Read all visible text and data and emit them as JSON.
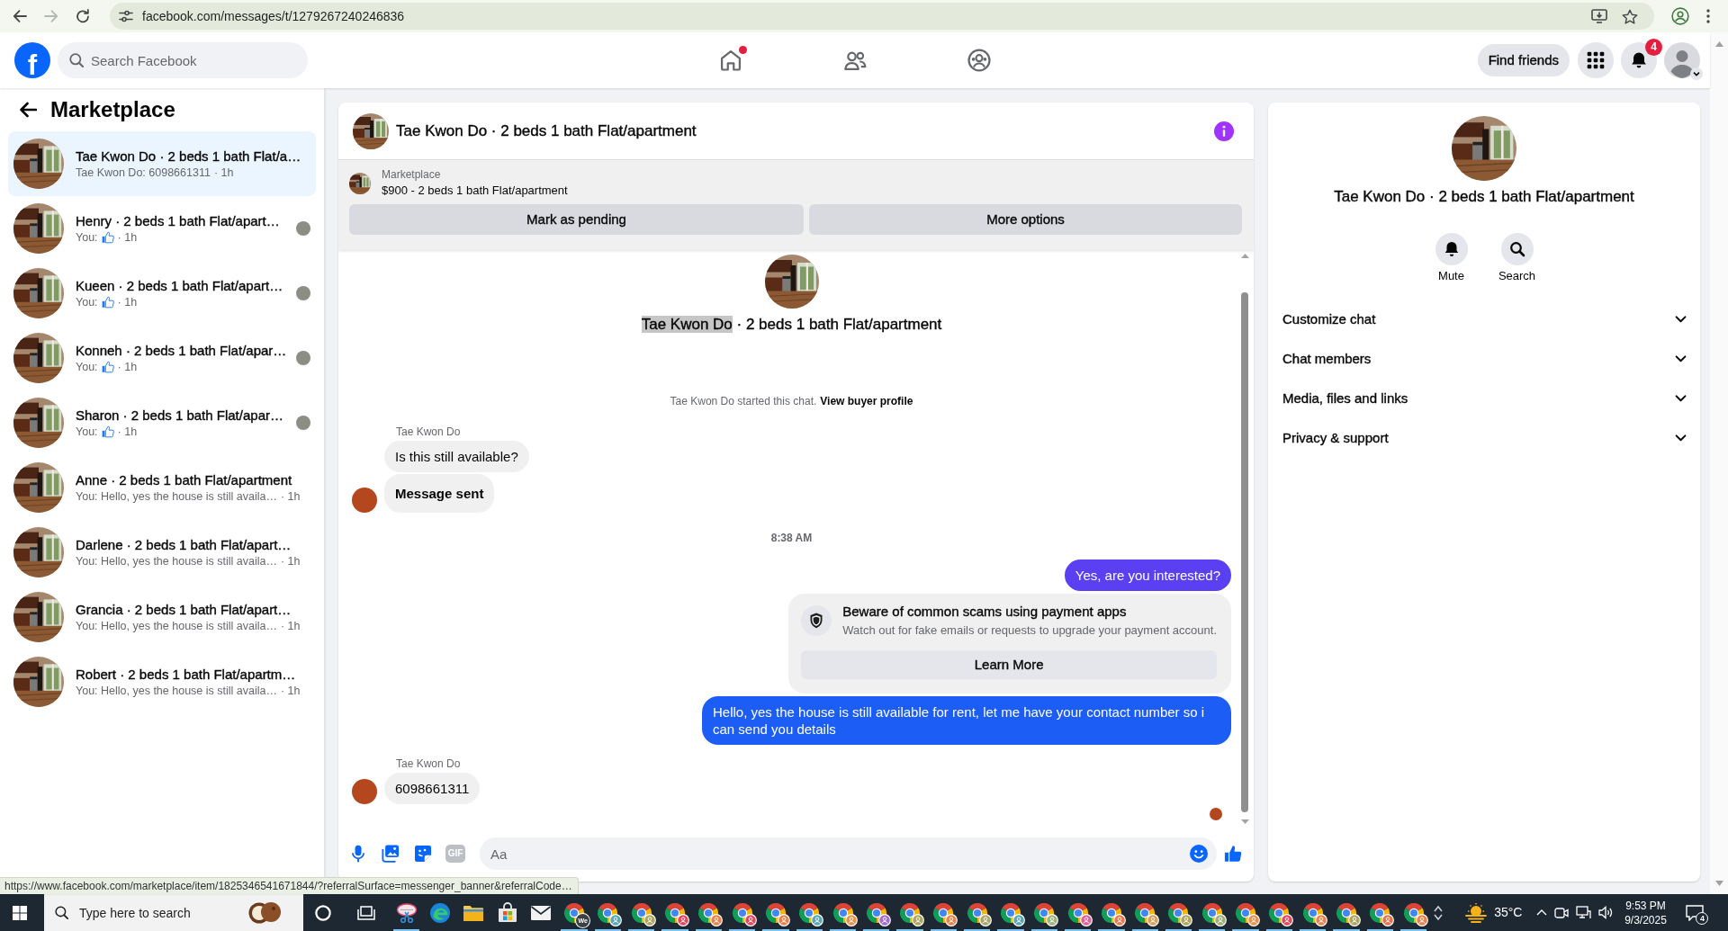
{
  "browser": {
    "nav": [
      {
        "kind": "back",
        "disabled": false
      },
      {
        "kind": "forward",
        "disabled": true
      },
      {
        "kind": "reload",
        "disabled": false
      }
    ],
    "url": "facebook.com/messages/t/1279267240246836",
    "status_url": "https://www.facebook.com/marketplace/item/1825346541671844/?referralSurface=messenger_banner&referralCode…"
  },
  "topnav": {
    "logo": "f",
    "search_placeholder": "Search Facebook",
    "tabs": [
      {
        "kind": "home",
        "selected": false,
        "dot": true
      },
      {
        "kind": "friends",
        "selected": false,
        "dot": false
      },
      {
        "kind": "groups",
        "selected": false,
        "dot": false
      }
    ],
    "find_friends": "Find friends",
    "notification_count": "4"
  },
  "sidebar": {
    "title": "Marketplace",
    "threads": [
      {
        "title": "Tae Kwon Do · 2 beds 1 bath Flat/a…",
        "kind": "text",
        "preview": "Tae Kwon Do: 6098661311",
        "time": "· 1h",
        "selected": true,
        "seen": false
      },
      {
        "title": "Henry · 2 beds 1 bath Flat/apart…",
        "kind": "like",
        "preview": "You:",
        "time": "· 1h",
        "selected": false,
        "seen": true
      },
      {
        "title": "Kueen · 2 beds 1 bath Flat/apart…",
        "kind": "like",
        "preview": "You:",
        "time": "· 1h",
        "selected": false,
        "seen": true
      },
      {
        "title": "Konneh · 2 beds 1 bath Flat/apar…",
        "kind": "like",
        "preview": "You:",
        "time": "· 1h",
        "selected": false,
        "seen": true
      },
      {
        "title": "Sharon · 2 beds 1 bath Flat/apar…",
        "kind": "like",
        "preview": "You:",
        "time": "· 1h",
        "selected": false,
        "seen": true
      },
      {
        "title": "Anne · 2 beds 1 bath Flat/apartment",
        "kind": "text",
        "preview": "You: Hello, yes the house is still availa…",
        "time": "· 1h",
        "selected": false,
        "seen": false
      },
      {
        "title": "Darlene · 2 beds 1 bath Flat/apart…",
        "kind": "text",
        "preview": "You: Hello, yes the house is still availa…",
        "time": "· 1h",
        "selected": false,
        "seen": false
      },
      {
        "title": "Grancia · 2 beds 1 bath Flat/apart…",
        "kind": "text",
        "preview": "You: Hello, yes the house is still availa…",
        "time": "· 1h",
        "selected": false,
        "seen": false
      },
      {
        "title": "Robert · 2 beds 1 bath Flat/apartm…",
        "kind": "text",
        "preview": "You: Hello, yes the house is still availa…",
        "time": "· 1h",
        "selected": false,
        "seen": false
      }
    ]
  },
  "chat": {
    "title": "Tae Kwon Do · 2 beds 1 bath Flat/apartment",
    "banner": {
      "label": "Marketplace",
      "listing": "$900 - 2 beds 1 bath Flat/apartment",
      "buttons": [
        "Mark as pending",
        "More options"
      ]
    },
    "intro": {
      "title": [
        {
          "text": "Tae Kwon Do",
          "highlighted": true
        },
        {
          "text": " · 2 beds 1 bath Flat/apartment",
          "highlighted": false
        }
      ],
      "started": "Tae Kwon Do started this chat.",
      "profile_link": "View buyer profile"
    },
    "messages": [
      {
        "kind": "name",
        "text": "Tae Kwon Do"
      },
      {
        "kind": "incoming",
        "text": "Is this still available?",
        "avatar": false,
        "bold": false
      },
      {
        "kind": "incoming",
        "text": "Message sent",
        "avatar": true,
        "bold": true
      },
      {
        "kind": "time",
        "text": "8:38 AM"
      },
      {
        "kind": "outgoing",
        "text": "Yes, are you interested?",
        "color": "#5a3ff3"
      },
      {
        "kind": "notice",
        "title": "Beware of common scams using payment apps",
        "body": "Watch out for fake emails or requests to upgrade your payment account.",
        "button": "Learn More"
      },
      {
        "kind": "outgoing",
        "text": "Hello, yes the house is still available for rent, let me have your contact number so i can send you details",
        "color": "#1b5df5"
      },
      {
        "kind": "name",
        "text": "Tae Kwon Do"
      },
      {
        "kind": "incoming",
        "text": "6098661311",
        "avatar": true,
        "bold": false
      },
      {
        "kind": "read_receipt"
      }
    ],
    "composer": {
      "gif": "GIF",
      "placeholder": "Aa"
    }
  },
  "details": {
    "title": "Tae Kwon Do · 2 beds 1 bath Flat/apartment",
    "actions": [
      {
        "kind": "mute",
        "label": "Mute"
      },
      {
        "kind": "search",
        "label": "Search"
      }
    ],
    "sections": [
      {
        "label": "Customize chat",
        "expanded": false
      },
      {
        "label": "Chat members",
        "expanded": false
      },
      {
        "label": "Media, files and links",
        "expanded": false
      },
      {
        "label": "Privacy & support",
        "expanded": false
      }
    ]
  },
  "taskbar": {
    "search_placeholder": "Type here to search",
    "apps": [
      {
        "kind": "snip",
        "running": true
      },
      {
        "kind": "edge",
        "running": false
      },
      {
        "kind": "explorer",
        "running": false
      },
      {
        "kind": "store",
        "running": false
      },
      {
        "kind": "mail",
        "running": false
      },
      {
        "kind": "chrome",
        "running": true,
        "color": "#3c4043",
        "badge_text": "We"
      },
      {
        "kind": "chrome",
        "running": true,
        "color": "#5aa6b3"
      },
      {
        "kind": "chrome",
        "running": true,
        "color": "#ada55d"
      },
      {
        "kind": "chrome",
        "running": true,
        "color": "#e2475b"
      },
      {
        "kind": "chrome",
        "running": true,
        "color": "#e8824b"
      },
      {
        "kind": "chrome",
        "running": true,
        "color": "#e2475b"
      },
      {
        "kind": "chrome",
        "running": true,
        "color": "#e8824b"
      },
      {
        "kind": "chrome",
        "running": true,
        "color": "#5aa6b3"
      },
      {
        "kind": "chrome",
        "running": true,
        "color": "#e8914b"
      },
      {
        "kind": "chrome",
        "running": true,
        "color": "#a46bd1"
      },
      {
        "kind": "chrome",
        "running": true,
        "color": "#ada55d"
      },
      {
        "kind": "chrome",
        "running": true,
        "color": "#e8824b"
      },
      {
        "kind": "chrome",
        "running": true,
        "color": "#a9a86a"
      },
      {
        "kind": "chrome",
        "running": true,
        "color": "#5aa6b3"
      },
      {
        "kind": "chrome",
        "running": true,
        "color": "#9fb27a"
      },
      {
        "kind": "chrome",
        "running": true,
        "color": "#e0609a"
      },
      {
        "kind": "chrome",
        "running": true,
        "color": "#e8784b"
      },
      {
        "kind": "chrome",
        "running": true,
        "color": "#d9a05a"
      },
      {
        "kind": "chrome",
        "running": true,
        "color": "#ada55d"
      },
      {
        "kind": "chrome",
        "running": true,
        "color": "#9fae76"
      },
      {
        "kind": "chrome",
        "running": true,
        "color": "#e8914b"
      },
      {
        "kind": "chrome",
        "running": true,
        "color": "#e2475b"
      },
      {
        "kind": "chrome",
        "running": true,
        "color": "#e8824b"
      },
      {
        "kind": "chrome",
        "running": true,
        "color": "#ada55d"
      },
      {
        "kind": "chrome",
        "running": true,
        "color": "#e8704b"
      },
      {
        "kind": "chrome",
        "running": true,
        "color": "#e8824b"
      }
    ],
    "weather": "35°C",
    "time": "9:53 PM",
    "date": "9/3/2025",
    "notifications": "4"
  }
}
